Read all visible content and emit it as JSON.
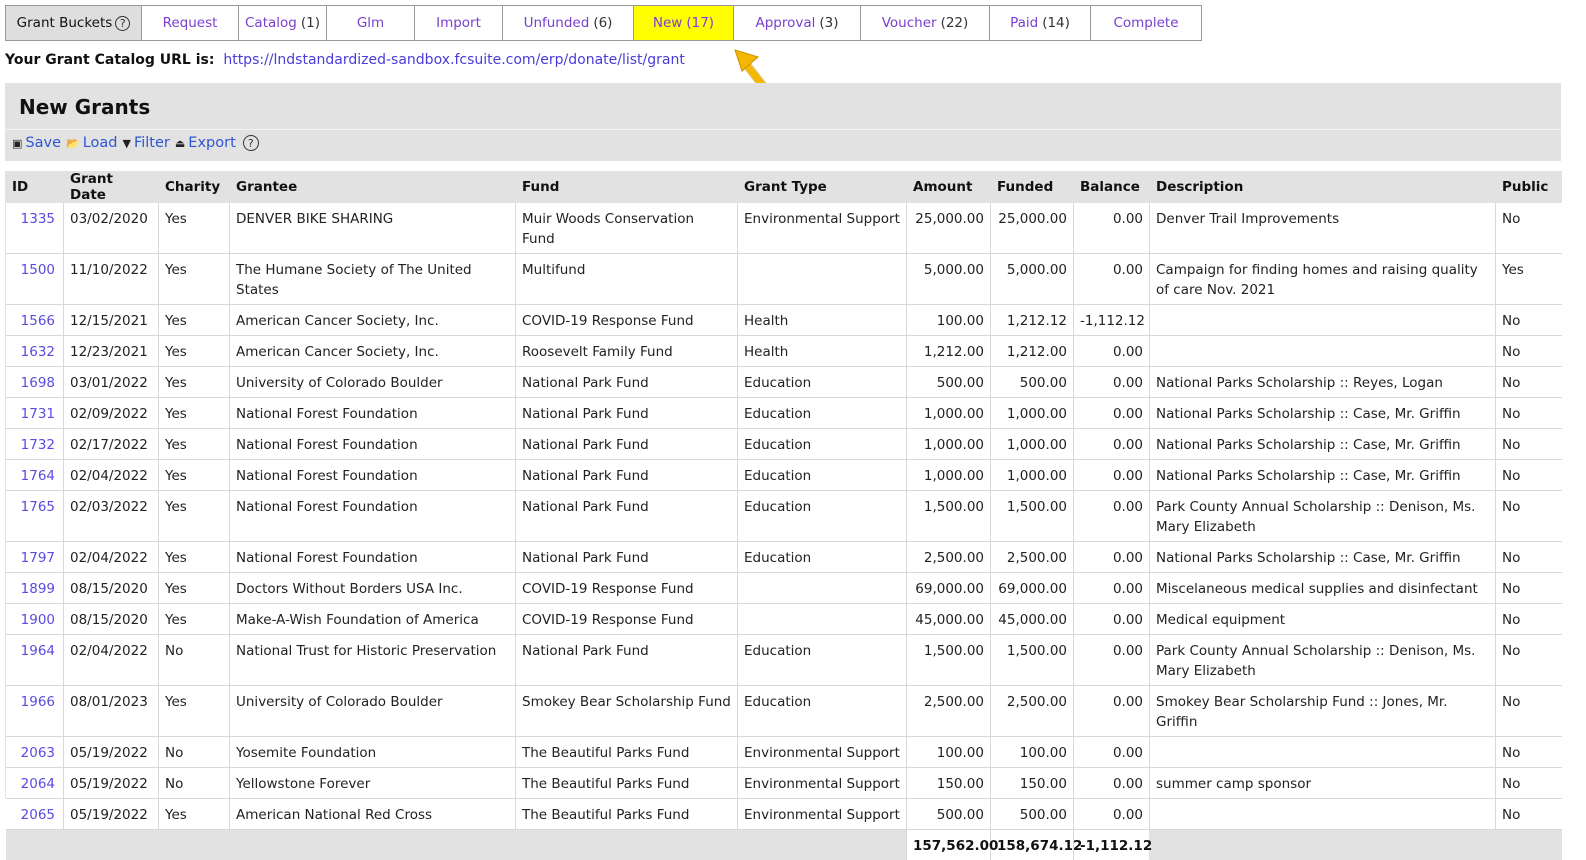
{
  "tabs": {
    "label": "Grant Buckets",
    "items": [
      {
        "label": "Request",
        "count": ""
      },
      {
        "label": "Catalog",
        "count": "(1)"
      },
      {
        "label": "Glm",
        "count": ""
      },
      {
        "label": "Import",
        "count": ""
      },
      {
        "label": "Unfunded",
        "count": "(6)"
      },
      {
        "label": "New",
        "count": "(17)"
      },
      {
        "label": "Approval",
        "count": "(3)"
      },
      {
        "label": "Voucher",
        "count": "(22)"
      },
      {
        "label": "Paid",
        "count": "(14)"
      },
      {
        "label": "Complete",
        "count": ""
      }
    ],
    "active": "New"
  },
  "catalog_url": {
    "label": "Your Grant Catalog URL is:",
    "url": "https://lndstandardized-sandbox.fcsuite.com/erp/donate/list/grant"
  },
  "panel": {
    "title": "New Grants",
    "toolbar": {
      "save": "Save",
      "load": "Load",
      "filter": "Filter",
      "export": "Export"
    }
  },
  "table": {
    "columns": [
      "ID",
      "Grant Date",
      "Charity",
      "Grantee",
      "Fund",
      "Grant Type",
      "Amount",
      "Funded",
      "Balance",
      "Description",
      "Public"
    ],
    "rows": [
      [
        "1335",
        "03/02/2020",
        "Yes",
        "DENVER BIKE SHARING",
        "Muir Woods Conservation Fund",
        "Environmental Support",
        "25,000.00",
        "25,000.00",
        "0.00",
        "Denver Trail Improvements",
        "No"
      ],
      [
        "1500",
        "11/10/2022",
        "Yes",
        "The Humane Society of The United States",
        "Multifund",
        "",
        "5,000.00",
        "5,000.00",
        "0.00",
        "Campaign for finding homes and raising quality of care Nov. 2021",
        "Yes"
      ],
      [
        "1566",
        "12/15/2021",
        "Yes",
        "American Cancer Society, Inc.",
        "COVID-19 Response Fund",
        "Health",
        "100.00",
        "1,212.12",
        "-1,112.12",
        "",
        "No"
      ],
      [
        "1632",
        "12/23/2021",
        "Yes",
        "American Cancer Society, Inc.",
        "Roosevelt Family Fund",
        "Health",
        "1,212.00",
        "1,212.00",
        "0.00",
        "",
        "No"
      ],
      [
        "1698",
        "03/01/2022",
        "Yes",
        "University of Colorado Boulder",
        "National Park Fund",
        "Education",
        "500.00",
        "500.00",
        "0.00",
        "National Parks Scholarship :: Reyes, Logan",
        "No"
      ],
      [
        "1731",
        "02/09/2022",
        "Yes",
        "National Forest Foundation",
        "National Park Fund",
        "Education",
        "1,000.00",
        "1,000.00",
        "0.00",
        "National Parks Scholarship :: Case, Mr. Griffin",
        "No"
      ],
      [
        "1732",
        "02/17/2022",
        "Yes",
        "National Forest Foundation",
        "National Park Fund",
        "Education",
        "1,000.00",
        "1,000.00",
        "0.00",
        "National Parks Scholarship :: Case, Mr. Griffin",
        "No"
      ],
      [
        "1764",
        "02/04/2022",
        "Yes",
        "National Forest Foundation",
        "National Park Fund",
        "Education",
        "1,000.00",
        "1,000.00",
        "0.00",
        "National Parks Scholarship :: Case, Mr. Griffin",
        "No"
      ],
      [
        "1765",
        "02/03/2022",
        "Yes",
        "National Forest Foundation",
        "National Park Fund",
        "Education",
        "1,500.00",
        "1,500.00",
        "0.00",
        "Park County Annual Scholarship :: Denison, Ms. Mary Elizabeth",
        "No"
      ],
      [
        "1797",
        "02/04/2022",
        "Yes",
        "National Forest Foundation",
        "National Park Fund",
        "Education",
        "2,500.00",
        "2,500.00",
        "0.00",
        "National Parks Scholarship :: Case, Mr. Griffin",
        "No"
      ],
      [
        "1899",
        "08/15/2020",
        "Yes",
        "Doctors Without Borders USA Inc.",
        "COVID-19 Response Fund",
        "",
        "69,000.00",
        "69,000.00",
        "0.00",
        "Miscelaneous medical supplies and disinfectant",
        "No"
      ],
      [
        "1900",
        "08/15/2020",
        "Yes",
        "Make-A-Wish Foundation of America",
        "COVID-19 Response Fund",
        "",
        "45,000.00",
        "45,000.00",
        "0.00",
        "Medical equipment",
        "No"
      ],
      [
        "1964",
        "02/04/2022",
        "No",
        "National Trust for Historic Preservation",
        "National Park Fund",
        "Education",
        "1,500.00",
        "1,500.00",
        "0.00",
        "Park County Annual Scholarship :: Denison, Ms. Mary Elizabeth",
        "No"
      ],
      [
        "1966",
        "08/01/2023",
        "Yes",
        "University of Colorado Boulder",
        "Smokey Bear Scholarship Fund",
        "Education",
        "2,500.00",
        "2,500.00",
        "0.00",
        "Smokey Bear Scholarship Fund :: Jones, Mr. Griffin",
        "No"
      ],
      [
        "2063",
        "05/19/2022",
        "No",
        "Yosemite Foundation",
        "The Beautiful Parks Fund",
        "Environmental Support",
        "100.00",
        "100.00",
        "0.00",
        "",
        "No"
      ],
      [
        "2064",
        "05/19/2022",
        "No",
        "Yellowstone Forever",
        "The Beautiful Parks Fund",
        "Environmental Support",
        "150.00",
        "150.00",
        "0.00",
        "summer camp sponsor",
        "No"
      ],
      [
        "2065",
        "05/19/2022",
        "Yes",
        "American National Red Cross",
        "The Beautiful Parks Fund",
        "Environmental Support",
        "500.00",
        "500.00",
        "0.00",
        "",
        "No"
      ]
    ],
    "totals": {
      "amount": "157,562.00",
      "funded": "158,674.12",
      "balance": "-1,112.12"
    }
  },
  "colors": {
    "active_tab": "#ffff00",
    "link": "#4a3cd8",
    "arrow": "#f5b800"
  }
}
